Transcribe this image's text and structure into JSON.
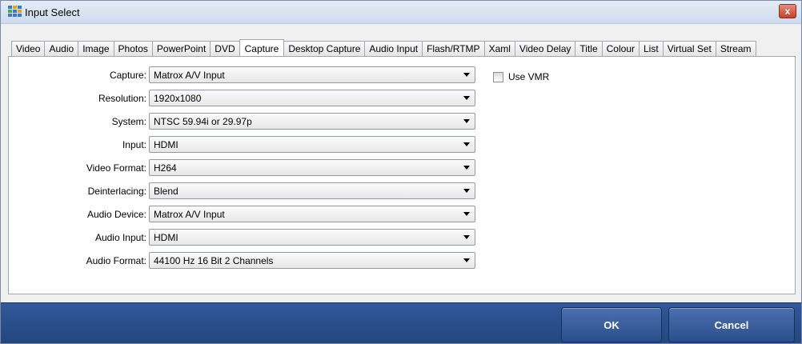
{
  "window": {
    "title": "Input Select",
    "close_label": "x"
  },
  "tabs": [
    {
      "label": "Video"
    },
    {
      "label": "Audio"
    },
    {
      "label": "Image"
    },
    {
      "label": "Photos"
    },
    {
      "label": "PowerPoint"
    },
    {
      "label": "DVD"
    },
    {
      "label": "Capture",
      "active": true
    },
    {
      "label": "Desktop Capture"
    },
    {
      "label": "Audio Input"
    },
    {
      "label": "Flash/RTMP"
    },
    {
      "label": "Xaml"
    },
    {
      "label": "Video Delay"
    },
    {
      "label": "Title"
    },
    {
      "label": "Colour"
    },
    {
      "label": "List"
    },
    {
      "label": "Virtual Set"
    },
    {
      "label": "Stream"
    }
  ],
  "form": {
    "fields": [
      {
        "label": "Capture:",
        "value": "Matrox A/V Input"
      },
      {
        "label": "Resolution:",
        "value": "1920x1080"
      },
      {
        "label": "System:",
        "value": "NTSC 59.94i or 29.97p"
      },
      {
        "label": "Input:",
        "value": "HDMI"
      },
      {
        "label": "Video Format:",
        "value": "H264"
      },
      {
        "label": "Deinterlacing:",
        "value": "Blend"
      },
      {
        "label": "Audio Device:",
        "value": "Matrox A/V  Input"
      },
      {
        "label": "Audio Input:",
        "value": "HDMI"
      },
      {
        "label": "Audio Format:",
        "value": "44100 Hz 16 Bit 2 Channels"
      }
    ],
    "use_vmr": {
      "label": "Use VMR",
      "checked": false
    }
  },
  "buttons": {
    "ok": "OK",
    "cancel": "Cancel"
  },
  "colors": {
    "footer": "#2b4f8c",
    "accent": "#3b79d1"
  }
}
